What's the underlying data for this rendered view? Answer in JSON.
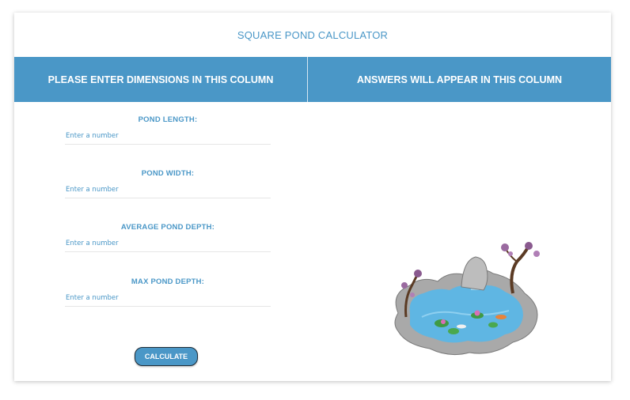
{
  "page": {
    "title": "SQUARE POND CALCULATOR"
  },
  "header": {
    "left": "PLEASE ENTER DIMENSIONS IN THIS COLUMN",
    "right": "ANSWERS WILL APPEAR IN THIS COLUMN"
  },
  "fields": [
    {
      "label": "POND LENGTH:",
      "placeholder": "Enter a number",
      "value": ""
    },
    {
      "label": "POND WIDTH:",
      "placeholder": "Enter a number",
      "value": ""
    },
    {
      "label": "AVERAGE POND DEPTH:",
      "placeholder": "Enter a number",
      "value": ""
    },
    {
      "label": "MAX POND DEPTH:",
      "placeholder": "Enter a number",
      "value": ""
    }
  ],
  "buttons": {
    "calculate": "CALCULATE"
  },
  "colors": {
    "accent": "#4a97c7",
    "header_text": "#ffffff",
    "water": "#5fb6e3"
  }
}
